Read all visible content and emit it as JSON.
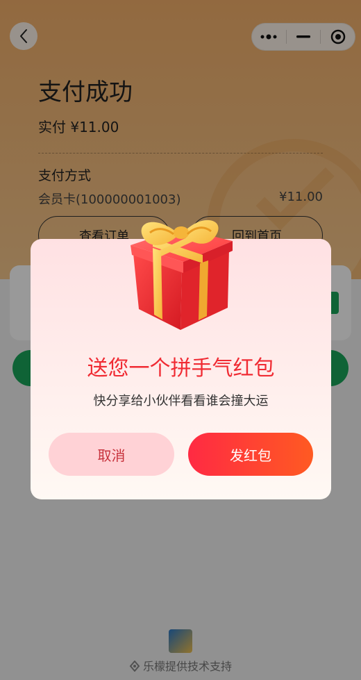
{
  "page": {
    "title": "支付成功",
    "paid_amount": "实付 ¥11.00",
    "payment_method_label": "支付方式",
    "card_label": "会员卡(100000001003)",
    "card_amount": "¥11.00",
    "view_order_label": "查看订单",
    "back_home_label": "回到首页"
  },
  "footer": {
    "support_text": "乐檬提供技术支持"
  },
  "modal": {
    "title": "送您一个拼手气红包",
    "subtitle": "快分享给小伙伴看看谁会撞大运",
    "cancel_label": "取消",
    "send_label": "发红包"
  },
  "icons": {
    "back": "chevron-left-icon",
    "more": "more-dots-icon",
    "minimize": "minus-icon",
    "close": "target-circle-icon",
    "gift": "gift-box-icon",
    "footer_logo": "leaf-logo-icon"
  },
  "colors": {
    "hero": "#f3b06b",
    "accent_red": "#f02b33",
    "send_gradient_start": "#ff2a43",
    "send_gradient_end": "#ff5a22",
    "cancel_bg": "#ffd2d6",
    "green": "#1aa55a"
  }
}
